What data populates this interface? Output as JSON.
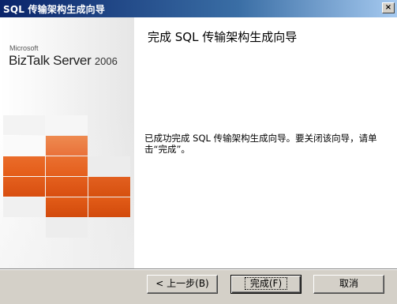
{
  "window": {
    "title": "SQL 传输架构生成向导",
    "close_glyph": "×"
  },
  "logo": {
    "company": "Microsoft",
    "product": "BizTalk Server",
    "version": "2006"
  },
  "page": {
    "heading": "完成 SQL 传输架构生成向导",
    "message": "已成功完成 SQL 传输架构生成向导。要关闭该向导，请单击“完成”。"
  },
  "buttons": {
    "back": "< 上一步(B)",
    "finish": "完成(F)",
    "cancel": "取消"
  },
  "colors": {
    "accent_orange": "#e8641e",
    "light_orange": "#ef8c4c",
    "titlebar": "#0a246a"
  }
}
